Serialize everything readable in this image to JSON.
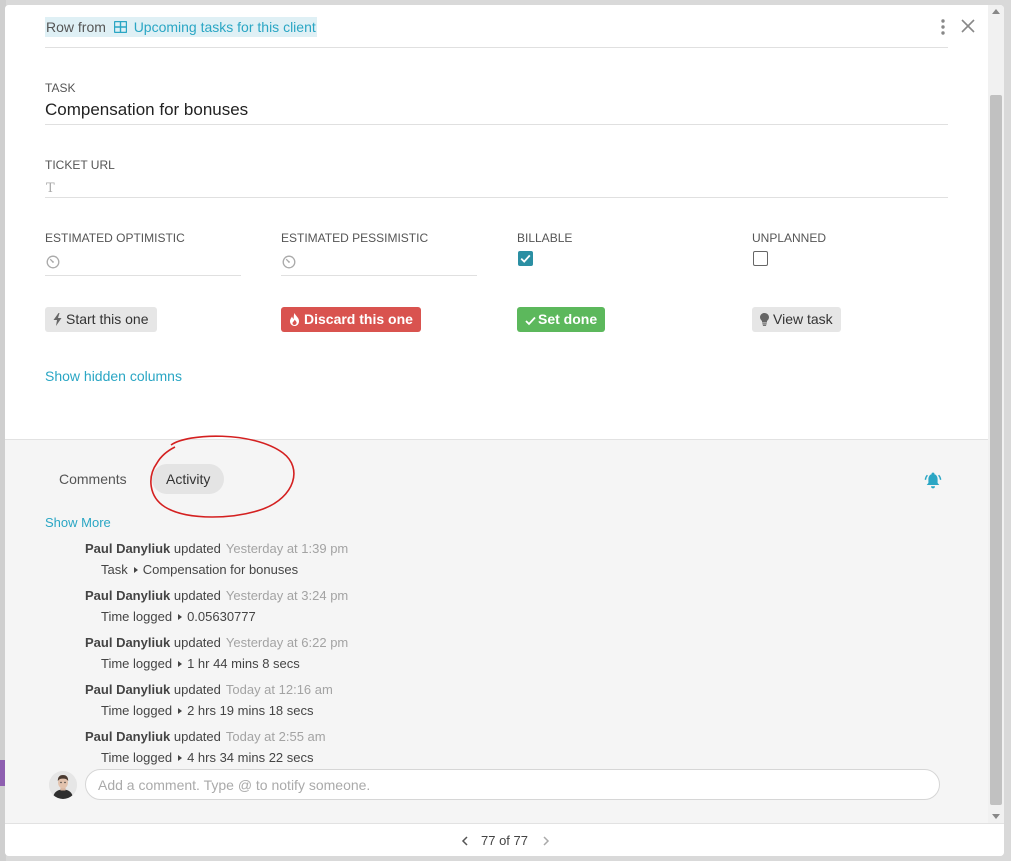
{
  "header": {
    "row_from": "Row from",
    "table_name": "Upcoming tasks for this client"
  },
  "fields": {
    "task_label": "TASK",
    "task_value": "Compensation for bonuses",
    "ticket_url_label": "TICKET URL",
    "ticket_url_icon": "T",
    "estimated_optimistic_label": "ESTIMATED OPTIMISTIC",
    "estimated_pessimistic_label": "ESTIMATED PESSIMISTIC",
    "billable_label": "BILLABLE",
    "billable_checked": true,
    "unplanned_label": "UNPLANNED",
    "unplanned_checked": false
  },
  "buttons": {
    "start": "Start this one",
    "discard": "Discard this one",
    "done": "Set done",
    "view": "View task"
  },
  "show_hidden_columns": "Show hidden columns",
  "tabs": {
    "comments": "Comments",
    "activity": "Activity",
    "active": "activity"
  },
  "show_more": "Show More",
  "activity": [
    {
      "user": "Paul Danyliuk",
      "action": "updated",
      "time": "Yesterday at 1:39 pm",
      "field": "Task",
      "value": "Compensation for bonuses"
    },
    {
      "user": "Paul Danyliuk",
      "action": "updated",
      "time": "Yesterday at 3:24 pm",
      "field": "Time logged",
      "value": "0.05630777"
    },
    {
      "user": "Paul Danyliuk",
      "action": "updated",
      "time": "Yesterday at 6:22 pm",
      "field": "Time logged",
      "value": "1 hr 44 mins 8 secs"
    },
    {
      "user": "Paul Danyliuk",
      "action": "updated",
      "time": "Today at 12:16 am",
      "field": "Time logged",
      "value": "2 hrs 19 mins 18 secs"
    },
    {
      "user": "Paul Danyliuk",
      "action": "updated",
      "time": "Today at 2:55 am",
      "field": "Time logged",
      "value": "4 hrs 34 mins 22 secs"
    }
  ],
  "comment": {
    "placeholder": "Add a comment. Type @ to notify someone.",
    "value": ""
  },
  "pager": {
    "current": "77 of 77"
  },
  "colors": {
    "accent": "#2aa6c4",
    "danger": "#d9534f",
    "success": "#5cb85c",
    "checkbox": "#2b8fa3",
    "annotation": "#d42020"
  },
  "icons": [
    "table-icon",
    "more-vertical-icon",
    "close-icon",
    "timer-icon",
    "lightning-icon",
    "fire-icon",
    "check-icon",
    "lightbulb-icon",
    "bell-icon",
    "chevron-left-icon",
    "chevron-right-icon"
  ]
}
